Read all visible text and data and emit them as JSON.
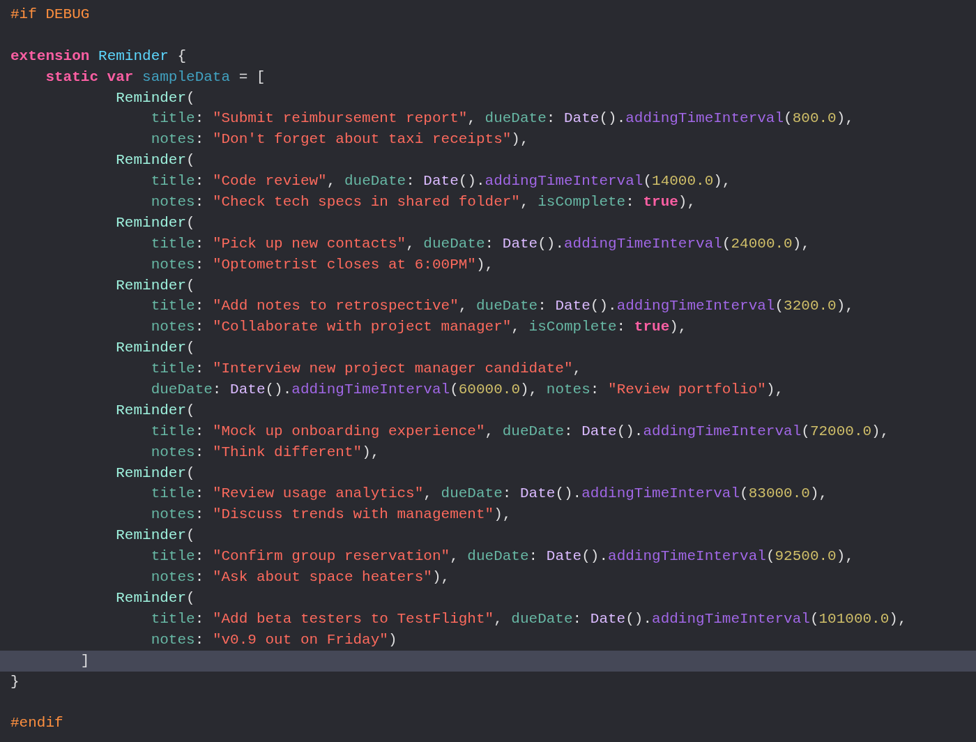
{
  "editor": {
    "lines": [
      {
        "current": false,
        "tokens": [
          {
            "kind": "preproc",
            "text": "#if DEBUG"
          }
        ]
      },
      {
        "current": false
      },
      {
        "current": false,
        "tokens": [
          {
            "kind": "keyword",
            "text": "extension "
          },
          {
            "kind": "type",
            "text": "Reminder"
          },
          {
            "kind": "plain",
            "text": " {"
          }
        ]
      },
      {
        "current": false,
        "tokens": [
          {
            "kind": "keyword",
            "text": "    static var"
          },
          {
            "kind": "var",
            "text": " sampleData"
          },
          {
            "kind": "plain",
            "text": " = ["
          }
        ]
      },
      {
        "current": false,
        "tokens": [
          {
            "kind": "call",
            "text": "            Reminder"
          },
          {
            "kind": "plain",
            "text": "("
          }
        ]
      },
      {
        "current": false,
        "tokens": [
          {
            "kind": "param",
            "text": "                title"
          },
          {
            "kind": "plain",
            "text": ": "
          },
          {
            "kind": "string",
            "text": "\"Submit reimbursement report\""
          },
          {
            "kind": "plain",
            "text": ", "
          },
          {
            "kind": "param",
            "text": "dueDate"
          },
          {
            "kind": "plain",
            "text": ": "
          },
          {
            "kind": "class",
            "text": "Date"
          },
          {
            "kind": "plain",
            "text": "()."
          },
          {
            "kind": "method",
            "text": "addingTimeInterval"
          },
          {
            "kind": "plain",
            "text": "("
          },
          {
            "kind": "number",
            "text": "800.0"
          },
          {
            "kind": "plain",
            "text": "),"
          }
        ]
      },
      {
        "current": false,
        "tokens": [
          {
            "kind": "param",
            "text": "                notes"
          },
          {
            "kind": "plain",
            "text": ": "
          },
          {
            "kind": "string",
            "text": "\"Don't forget about taxi receipts\""
          },
          {
            "kind": "plain",
            "text": "),"
          }
        ]
      },
      {
        "current": false,
        "tokens": [
          {
            "kind": "call",
            "text": "            Reminder"
          },
          {
            "kind": "plain",
            "text": "("
          }
        ]
      },
      {
        "current": false,
        "tokens": [
          {
            "kind": "param",
            "text": "                title"
          },
          {
            "kind": "plain",
            "text": ": "
          },
          {
            "kind": "string",
            "text": "\"Code review\""
          },
          {
            "kind": "plain",
            "text": ", "
          },
          {
            "kind": "param",
            "text": "dueDate"
          },
          {
            "kind": "plain",
            "text": ": "
          },
          {
            "kind": "class",
            "text": "Date"
          },
          {
            "kind": "plain",
            "text": "()."
          },
          {
            "kind": "method",
            "text": "addingTimeInterval"
          },
          {
            "kind": "plain",
            "text": "("
          },
          {
            "kind": "number",
            "text": "14000.0"
          },
          {
            "kind": "plain",
            "text": "),"
          }
        ]
      },
      {
        "current": false,
        "tokens": [
          {
            "kind": "param",
            "text": "                notes"
          },
          {
            "kind": "plain",
            "text": ": "
          },
          {
            "kind": "string",
            "text": "\"Check tech specs in shared folder\""
          },
          {
            "kind": "plain",
            "text": ", "
          },
          {
            "kind": "param",
            "text": "isComplete"
          },
          {
            "kind": "plain",
            "text": ": "
          },
          {
            "kind": "keyword",
            "text": "true"
          },
          {
            "kind": "plain",
            "text": "),"
          }
        ]
      },
      {
        "current": false,
        "tokens": [
          {
            "kind": "call",
            "text": "            Reminder"
          },
          {
            "kind": "plain",
            "text": "("
          }
        ]
      },
      {
        "current": false,
        "tokens": [
          {
            "kind": "param",
            "text": "                title"
          },
          {
            "kind": "plain",
            "text": ": "
          },
          {
            "kind": "string",
            "text": "\"Pick up new contacts\""
          },
          {
            "kind": "plain",
            "text": ", "
          },
          {
            "kind": "param",
            "text": "dueDate"
          },
          {
            "kind": "plain",
            "text": ": "
          },
          {
            "kind": "class",
            "text": "Date"
          },
          {
            "kind": "plain",
            "text": "()."
          },
          {
            "kind": "method",
            "text": "addingTimeInterval"
          },
          {
            "kind": "plain",
            "text": "("
          },
          {
            "kind": "number",
            "text": "24000.0"
          },
          {
            "kind": "plain",
            "text": "),"
          }
        ]
      },
      {
        "current": false,
        "tokens": [
          {
            "kind": "param",
            "text": "                notes"
          },
          {
            "kind": "plain",
            "text": ": "
          },
          {
            "kind": "string",
            "text": "\"Optometrist closes at 6:00PM\""
          },
          {
            "kind": "plain",
            "text": "),"
          }
        ]
      },
      {
        "current": false,
        "tokens": [
          {
            "kind": "call",
            "text": "            Reminder"
          },
          {
            "kind": "plain",
            "text": "("
          }
        ]
      },
      {
        "current": false,
        "tokens": [
          {
            "kind": "param",
            "text": "                title"
          },
          {
            "kind": "plain",
            "text": ": "
          },
          {
            "kind": "string",
            "text": "\"Add notes to retrospective\""
          },
          {
            "kind": "plain",
            "text": ", "
          },
          {
            "kind": "param",
            "text": "dueDate"
          },
          {
            "kind": "plain",
            "text": ": "
          },
          {
            "kind": "class",
            "text": "Date"
          },
          {
            "kind": "plain",
            "text": "()."
          },
          {
            "kind": "method",
            "text": "addingTimeInterval"
          },
          {
            "kind": "plain",
            "text": "("
          },
          {
            "kind": "number",
            "text": "3200.0"
          },
          {
            "kind": "plain",
            "text": "),"
          }
        ]
      },
      {
        "current": false,
        "tokens": [
          {
            "kind": "param",
            "text": "                notes"
          },
          {
            "kind": "plain",
            "text": ": "
          },
          {
            "kind": "string",
            "text": "\"Collaborate with project manager\""
          },
          {
            "kind": "plain",
            "text": ", "
          },
          {
            "kind": "param",
            "text": "isComplete"
          },
          {
            "kind": "plain",
            "text": ": "
          },
          {
            "kind": "keyword",
            "text": "true"
          },
          {
            "kind": "plain",
            "text": "),"
          }
        ]
      },
      {
        "current": false,
        "tokens": [
          {
            "kind": "call",
            "text": "            Reminder"
          },
          {
            "kind": "plain",
            "text": "("
          }
        ]
      },
      {
        "current": false,
        "tokens": [
          {
            "kind": "param",
            "text": "                title"
          },
          {
            "kind": "plain",
            "text": ": "
          },
          {
            "kind": "string",
            "text": "\"Interview new project manager candidate\""
          },
          {
            "kind": "plain",
            "text": ","
          }
        ]
      },
      {
        "current": false,
        "tokens": [
          {
            "kind": "param",
            "text": "                dueDate"
          },
          {
            "kind": "plain",
            "text": ": "
          },
          {
            "kind": "class",
            "text": "Date"
          },
          {
            "kind": "plain",
            "text": "()."
          },
          {
            "kind": "method",
            "text": "addingTimeInterval"
          },
          {
            "kind": "plain",
            "text": "("
          },
          {
            "kind": "number",
            "text": "60000.0"
          },
          {
            "kind": "plain",
            "text": "), "
          },
          {
            "kind": "param",
            "text": "notes"
          },
          {
            "kind": "plain",
            "text": ": "
          },
          {
            "kind": "string",
            "text": "\"Review portfolio\""
          },
          {
            "kind": "plain",
            "text": "),"
          }
        ]
      },
      {
        "current": false,
        "tokens": [
          {
            "kind": "call",
            "text": "            Reminder"
          },
          {
            "kind": "plain",
            "text": "("
          }
        ]
      },
      {
        "current": false,
        "tokens": [
          {
            "kind": "param",
            "text": "                title"
          },
          {
            "kind": "plain",
            "text": ": "
          },
          {
            "kind": "string",
            "text": "\"Mock up onboarding experience\""
          },
          {
            "kind": "plain",
            "text": ", "
          },
          {
            "kind": "param",
            "text": "dueDate"
          },
          {
            "kind": "plain",
            "text": ": "
          },
          {
            "kind": "class",
            "text": "Date"
          },
          {
            "kind": "plain",
            "text": "()."
          },
          {
            "kind": "method",
            "text": "addingTimeInterval"
          },
          {
            "kind": "plain",
            "text": "("
          },
          {
            "kind": "number",
            "text": "72000.0"
          },
          {
            "kind": "plain",
            "text": "),"
          }
        ]
      },
      {
        "current": false,
        "tokens": [
          {
            "kind": "param",
            "text": "                notes"
          },
          {
            "kind": "plain",
            "text": ": "
          },
          {
            "kind": "string",
            "text": "\"Think different\""
          },
          {
            "kind": "plain",
            "text": "),"
          }
        ]
      },
      {
        "current": false,
        "tokens": [
          {
            "kind": "call",
            "text": "            Reminder"
          },
          {
            "kind": "plain",
            "text": "("
          }
        ]
      },
      {
        "current": false,
        "tokens": [
          {
            "kind": "param",
            "text": "                title"
          },
          {
            "kind": "plain",
            "text": ": "
          },
          {
            "kind": "string",
            "text": "\"Review usage analytics\""
          },
          {
            "kind": "plain",
            "text": ", "
          },
          {
            "kind": "param",
            "text": "dueDate"
          },
          {
            "kind": "plain",
            "text": ": "
          },
          {
            "kind": "class",
            "text": "Date"
          },
          {
            "kind": "plain",
            "text": "()."
          },
          {
            "kind": "method",
            "text": "addingTimeInterval"
          },
          {
            "kind": "plain",
            "text": "("
          },
          {
            "kind": "number",
            "text": "83000.0"
          },
          {
            "kind": "plain",
            "text": "),"
          }
        ]
      },
      {
        "current": false,
        "tokens": [
          {
            "kind": "param",
            "text": "                notes"
          },
          {
            "kind": "plain",
            "text": ": "
          },
          {
            "kind": "string",
            "text": "\"Discuss trends with management\""
          },
          {
            "kind": "plain",
            "text": "),"
          }
        ]
      },
      {
        "current": false,
        "tokens": [
          {
            "kind": "call",
            "text": "            Reminder"
          },
          {
            "kind": "plain",
            "text": "("
          }
        ]
      },
      {
        "current": false,
        "tokens": [
          {
            "kind": "param",
            "text": "                title"
          },
          {
            "kind": "plain",
            "text": ": "
          },
          {
            "kind": "string",
            "text": "\"Confirm group reservation\""
          },
          {
            "kind": "plain",
            "text": ", "
          },
          {
            "kind": "param",
            "text": "dueDate"
          },
          {
            "kind": "plain",
            "text": ": "
          },
          {
            "kind": "class",
            "text": "Date"
          },
          {
            "kind": "plain",
            "text": "()."
          },
          {
            "kind": "method",
            "text": "addingTimeInterval"
          },
          {
            "kind": "plain",
            "text": "("
          },
          {
            "kind": "number",
            "text": "92500.0"
          },
          {
            "kind": "plain",
            "text": "),"
          }
        ]
      },
      {
        "current": false,
        "tokens": [
          {
            "kind": "param",
            "text": "                notes"
          },
          {
            "kind": "plain",
            "text": ": "
          },
          {
            "kind": "string",
            "text": "\"Ask about space heaters\""
          },
          {
            "kind": "plain",
            "text": "),"
          }
        ]
      },
      {
        "current": false,
        "tokens": [
          {
            "kind": "call",
            "text": "            Reminder"
          },
          {
            "kind": "plain",
            "text": "("
          }
        ]
      },
      {
        "current": false,
        "tokens": [
          {
            "kind": "param",
            "text": "                title"
          },
          {
            "kind": "plain",
            "text": ": "
          },
          {
            "kind": "string",
            "text": "\"Add beta testers to TestFlight\""
          },
          {
            "kind": "plain",
            "text": ", "
          },
          {
            "kind": "param",
            "text": "dueDate"
          },
          {
            "kind": "plain",
            "text": ": "
          },
          {
            "kind": "class",
            "text": "Date"
          },
          {
            "kind": "plain",
            "text": "()."
          },
          {
            "kind": "method",
            "text": "addingTimeInterval"
          },
          {
            "kind": "plain",
            "text": "("
          },
          {
            "kind": "number",
            "text": "101000.0"
          },
          {
            "kind": "plain",
            "text": "),"
          }
        ]
      },
      {
        "current": false,
        "tokens": [
          {
            "kind": "param",
            "text": "                notes"
          },
          {
            "kind": "plain",
            "text": ": "
          },
          {
            "kind": "string",
            "text": "\"v0.9 out on Friday\""
          },
          {
            "kind": "plain",
            "text": ")"
          }
        ]
      },
      {
        "current": true,
        "tokens": [
          {
            "kind": "plain",
            "text": "        ]"
          }
        ]
      },
      {
        "current": false,
        "tokens": [
          {
            "kind": "plain",
            "text": "}"
          }
        ]
      },
      {
        "current": false
      },
      {
        "current": false,
        "tokens": [
          {
            "kind": "preproc",
            "text": "#endif"
          }
        ]
      }
    ]
  }
}
